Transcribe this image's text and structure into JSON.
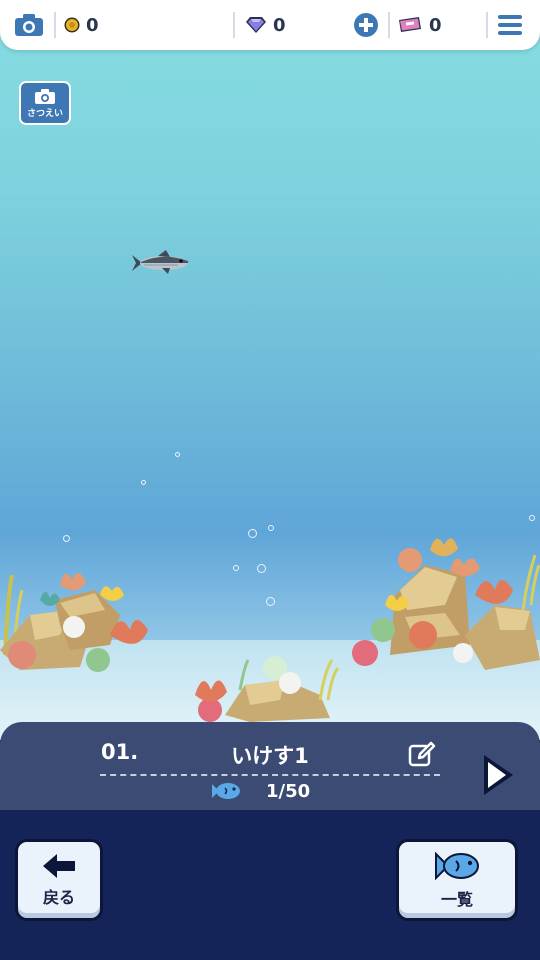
{
  "top_bar": {
    "camera_icon": "camera-icon",
    "coins": "0",
    "gems": "0",
    "tickets": "0",
    "menu_icon": "hamburger-menu-icon"
  },
  "photo_button": {
    "label": "さつえい"
  },
  "tank": {
    "number": "01.",
    "name": "いけす1",
    "fish_count": "1/50"
  },
  "buttons": {
    "back_label": "戻る",
    "list_label": "一覧"
  }
}
